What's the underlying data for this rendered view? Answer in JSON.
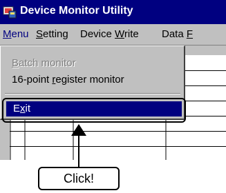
{
  "window": {
    "title": "Device Monitor Utility",
    "app_icon": "device-monitor-app-icon"
  },
  "menubar": {
    "items": [
      {
        "label": "Menu",
        "mnemonic_index": 0
      },
      {
        "label": "Setting",
        "mnemonic_index": 0
      },
      {
        "label": "Device Write",
        "mnemonic_index": 7
      },
      {
        "label": "Data F",
        "mnemonic_index": 5
      }
    ]
  },
  "dropdown": {
    "items": [
      {
        "label": "Batch monitor",
        "enabled": false
      },
      {
        "label": "16-point register monitor",
        "enabled": true
      },
      {
        "label": "Exit",
        "enabled": true,
        "highlighted": true
      }
    ]
  },
  "annotation": {
    "callout_text": "Click!",
    "arrow_icon": "up-arrow-icon"
  },
  "colors": {
    "title_bar": "#000080",
    "menu_highlight": "#000080",
    "face": "#c0c0c0",
    "disabled_text": "#808080"
  }
}
